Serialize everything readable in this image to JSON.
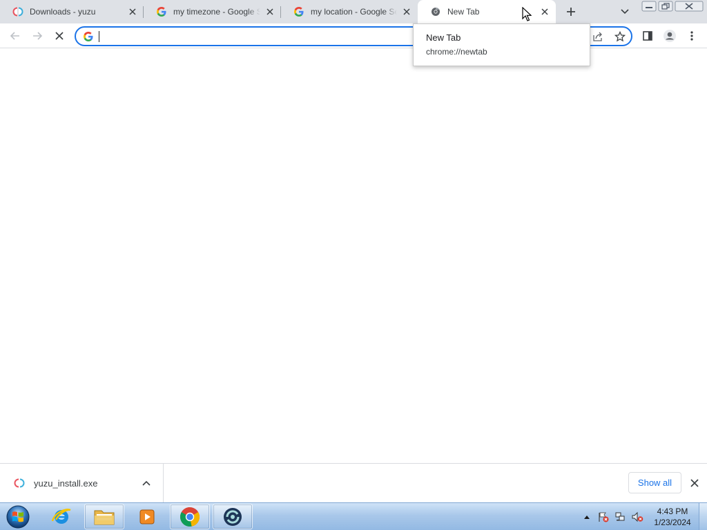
{
  "browser": {
    "tabs": [
      {
        "title": "Downloads - yuzu",
        "favicon": "yuzu-icon",
        "active": false
      },
      {
        "title": "my timezone - Google Search",
        "favicon": "google-icon",
        "active": false
      },
      {
        "title": "my location - Google Search",
        "favicon": "google-icon",
        "active": false
      },
      {
        "title": "New Tab",
        "favicon": "chrome-icon",
        "active": true
      }
    ],
    "hover_card": {
      "title": "New Tab",
      "url": "chrome://newtab"
    },
    "omnibox": {
      "value": "",
      "placeholder": ""
    }
  },
  "downloads": {
    "file": "yuzu_install.exe",
    "show_all_label": "Show all"
  },
  "taskbar": {
    "clock_time": "4:43 PM",
    "clock_date": "1/23/2024"
  },
  "colors": {
    "accent": "#1a73e8",
    "tabstrip": "#dee1e6",
    "taskbar": "#a9c8ea"
  }
}
